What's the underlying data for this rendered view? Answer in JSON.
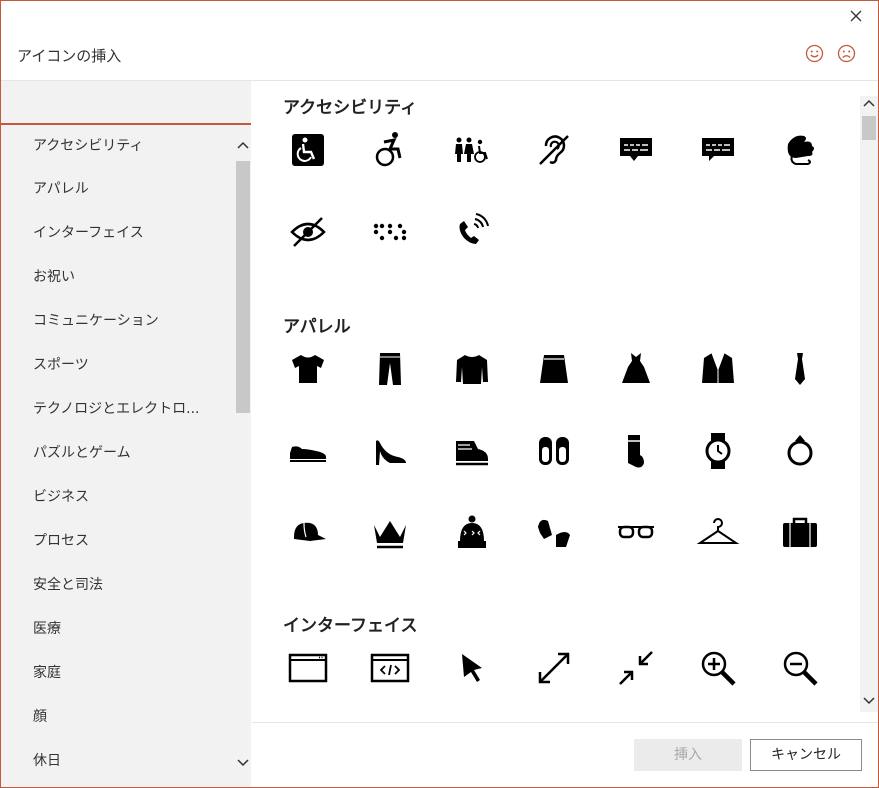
{
  "dialog": {
    "title": "アイコンの挿入",
    "close_icon": "close-icon",
    "feedback": {
      "smile_icon": "smile-icon",
      "frown_icon": "frown-icon"
    }
  },
  "search": {
    "value": "",
    "placeholder": ""
  },
  "categories": [
    "アクセシビリティ",
    "アパレル",
    "インターフェイス",
    "お祝い",
    "コミュニケーション",
    "スポーツ",
    "テクノロジとエレクトロ...",
    "パズルとゲーム",
    "ビジネス",
    "プロセス",
    "安全と司法",
    "医療",
    "家庭",
    "顔",
    "休日"
  ],
  "sections": [
    {
      "title": "アクセシビリティ",
      "icons": [
        "accessible-sign-icon",
        "wheelchair-active-icon",
        "family-restroom-icon",
        "hearing-impaired-icon",
        "closed-caption-bubble-icon",
        "captioning-bubble-icon",
        "sign-language-icon",
        "low-vision-icon",
        "braille-icon",
        "volume-control-phone-icon"
      ]
    },
    {
      "title": "アパレル",
      "icons": [
        "tshirt-icon",
        "jeans-icon",
        "sweater-icon",
        "skirt-icon",
        "dress-icon",
        "suit-jacket-icon",
        "necktie-icon",
        "dress-shoe-icon",
        "high-heel-icon",
        "boot-icon",
        "slippers-icon",
        "sock-icon",
        "wristwatch-icon",
        "ring-icon",
        "baseball-cap-icon",
        "crown-icon",
        "winter-hat-icon",
        "mittens-icon",
        "glasses-icon",
        "hanger-icon",
        "suitcase-icon"
      ]
    },
    {
      "title": "インターフェイス",
      "icons": [
        "browser-window-icon",
        "code-window-icon",
        "cursor-arrow-icon",
        "expand-arrows-icon",
        "collapse-arrows-icon",
        "zoom-in-icon",
        "zoom-out-icon"
      ]
    }
  ],
  "footer": {
    "insert_label": "挿入",
    "cancel_label": "キャンセル"
  },
  "colors": {
    "accent": "#c55a3a",
    "panel": "#f2f2f2",
    "disabled_button": "#ebebeb"
  }
}
